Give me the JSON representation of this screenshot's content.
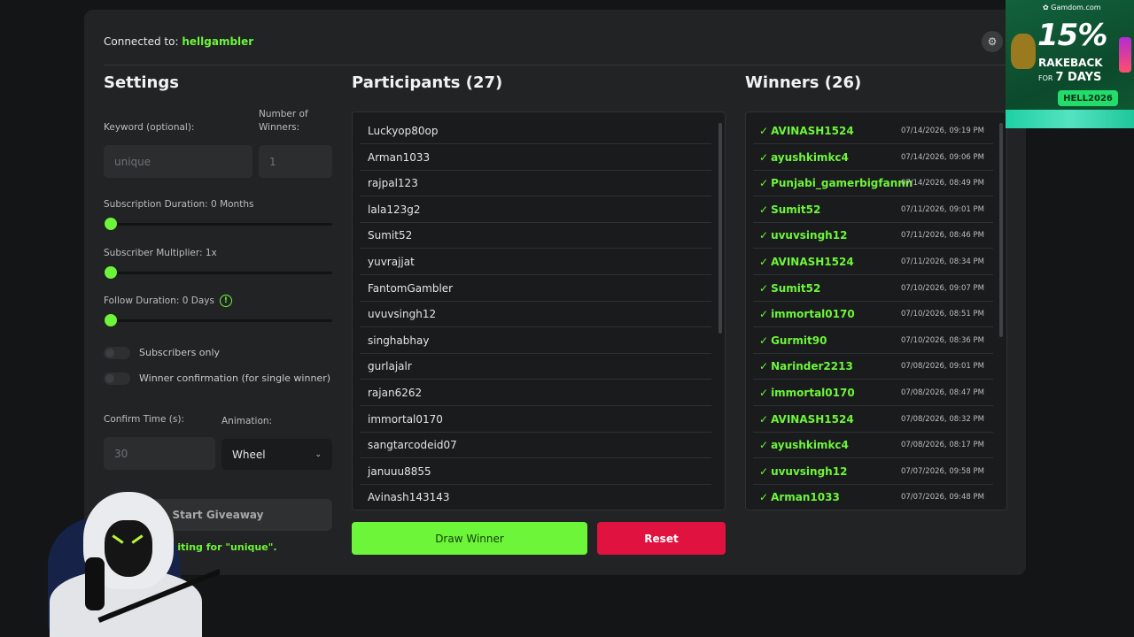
{
  "header": {
    "connected_label": "Connected to:",
    "channel": "hellgambler",
    "gear_icon": "settings-gear-icon"
  },
  "settings": {
    "title": "Settings",
    "keyword_label": "Keyword (optional):",
    "keyword_placeholder": "unique",
    "winners_label": "Number of Winners:",
    "winners_placeholder": "1",
    "subscription_label": "Subscription Duration: 0 Months",
    "subscription_value": 0,
    "multiplier_label": "Subscriber Multiplier: 1x",
    "multiplier_value": 0,
    "follow_label": "Follow Duration: 0 Days",
    "follow_value": 0,
    "info_glyph": "!",
    "subscribers_only_label": "Subscribers only",
    "winner_confirm_label": "Winner confirmation (for single winner)",
    "confirm_time_label": "Confirm Time (s):",
    "confirm_time_placeholder": "30",
    "animation_label": "Animation:",
    "animation_value": "Wheel",
    "start_button": "Start Giveaway",
    "chat_status": "d to chat! Waiting for \"unique\"."
  },
  "participants": {
    "title": "Participants (27)",
    "items": [
      "Luckyop80op",
      "Arman1033",
      "rajpal123",
      "lala123g2",
      "Sumit52",
      "yuvrajjat",
      "FantomGambler",
      "uvuvsingh12",
      "singhabhay",
      "gurlajalr",
      "rajan6262",
      "immortal0170",
      "sangtarcodeid07",
      "januuu8855",
      "Avinash143143"
    ]
  },
  "winners": {
    "title": "Winners (26)",
    "check": "✓",
    "items": [
      {
        "name": "AVINASH1524",
        "time": "07/14/2026, 09:19 PM"
      },
      {
        "name": "ayushkimkc4",
        "time": "07/14/2026, 09:06 PM"
      },
      {
        "name": "Punjabi_gamerbigfannn",
        "time": "07/14/2026, 08:49 PM"
      },
      {
        "name": "Sumit52",
        "time": "07/11/2026, 09:01 PM"
      },
      {
        "name": "uvuvsingh12",
        "time": "07/11/2026, 08:46 PM"
      },
      {
        "name": "AVINASH1524",
        "time": "07/11/2026, 08:34 PM"
      },
      {
        "name": "Sumit52",
        "time": "07/10/2026, 09:07 PM"
      },
      {
        "name": "immortal0170",
        "time": "07/10/2026, 08:51 PM"
      },
      {
        "name": "Gurmit90",
        "time": "07/10/2026, 08:36 PM"
      },
      {
        "name": "Narinder2213",
        "time": "07/08/2026, 09:01 PM"
      },
      {
        "name": "immortal0170",
        "time": "07/08/2026, 08:47 PM"
      },
      {
        "name": "AVINASH1524",
        "time": "07/08/2026, 08:32 PM"
      },
      {
        "name": "ayushkimkc4",
        "time": "07/08/2026, 08:17 PM"
      },
      {
        "name": "uvuvsingh12",
        "time": "07/07/2026, 09:58 PM"
      },
      {
        "name": "Arman1033",
        "time": "07/07/2026, 09:48 PM"
      }
    ]
  },
  "actions": {
    "draw_winner": "Draw Winner",
    "reset": "Reset"
  },
  "ad": {
    "brand": "Gamdom.com",
    "headline": "15%",
    "rakeback": "RAKEBACK",
    "for_text": "FOR",
    "duration": "7 DAYS",
    "code": "HELL2026"
  },
  "colors": {
    "accent": "#6df53a",
    "danger": "#e0123f",
    "panel": "#212324",
    "background": "#141516"
  }
}
